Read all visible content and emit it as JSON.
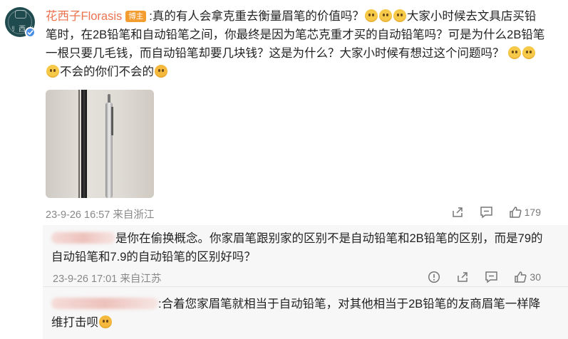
{
  "post": {
    "username": "花西子Florasis",
    "badge": "博主",
    "line1": ":真的有人会拿克重去衡量眉笔的价值吗？",
    "line1b": "大家小时候去文具店买铅",
    "line2": "笔时，在2B铅笔和自动铅笔之间，你最终是因为笔芯克重才买的自动铅笔吗？可是为什么2B铅笔",
    "line3": "一根只要几毛钱，而自动铅笔却要几块钱？这是为什么？大家小时候有想过这个问题吗？",
    "line4": "不会的你们不会的",
    "timestamp": "23-9-26 16:57",
    "location": "来自浙江",
    "likes": "179",
    "emoji_name": "sad-face-emoji"
  },
  "reply1": {
    "line1": "是你在偷换概念。你家眉笔跟别家的区别不是自动铅笔和2B铅笔的区别，而是79的",
    "line2": "自动铅笔和7.9的自动铅笔的区别好吗？",
    "timestamp": "23-9-26 17:01",
    "location": "来自江苏",
    "likes": "30"
  },
  "reply2": {
    "line1": ":合着您家眉笔就相当于自动铅笔，对其他相当于2B铅笔的友商眉笔一样降",
    "line2": "维打击呗"
  },
  "icons": [
    "verified-icon",
    "share-icon",
    "comment-icon",
    "like-icon",
    "report-icon"
  ],
  "colors": {
    "username": "#eb7350",
    "badge": "#f39c2f",
    "verified": "#4a8ee6"
  }
}
